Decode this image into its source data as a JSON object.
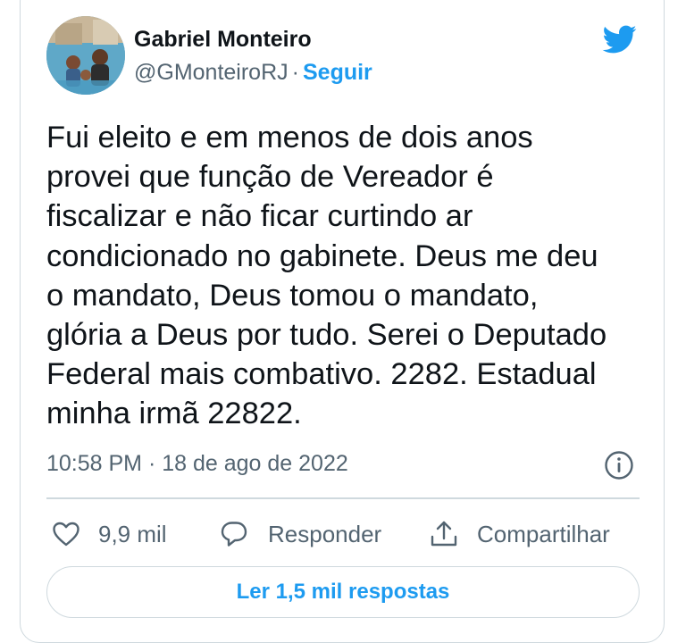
{
  "author": {
    "name": "Gabriel Monteiro",
    "handle": "@GMonteiroRJ",
    "separator": "·",
    "follow_label": "Seguir",
    "avatar_icon": "profile-photo"
  },
  "brand": {
    "icon": "twitter-bird-icon",
    "color": "#1d9bf0"
  },
  "tweet": {
    "text": "Fui eleito e em menos de dois anos\nprovei que função de Vereador é\nfiscalizar e não ficar curtindo ar\ncondicionado no gabinete. Deus me deu\no mandato, Deus tomou o mandato,\nglória a Deus por tudo. Serei o Deputado\nFederal mais combativo. 2282. Estadual\nminha irmã 22822.",
    "timestamp": "10:58 PM · 18 de ago de 2022",
    "info_icon": "info-icon"
  },
  "actions": {
    "like": {
      "icon": "heart-icon",
      "label": "9,9 mil"
    },
    "reply": {
      "icon": "speech-bubble-icon",
      "label": "Responder"
    },
    "share": {
      "icon": "share-upload-icon",
      "label": "Compartilhar"
    }
  },
  "replies_button": {
    "label": "Ler 1,5 mil respostas"
  },
  "colors": {
    "text": "#0f1419",
    "secondary": "#536471",
    "accent": "#1d9bf0",
    "border": "#cfd9de"
  }
}
